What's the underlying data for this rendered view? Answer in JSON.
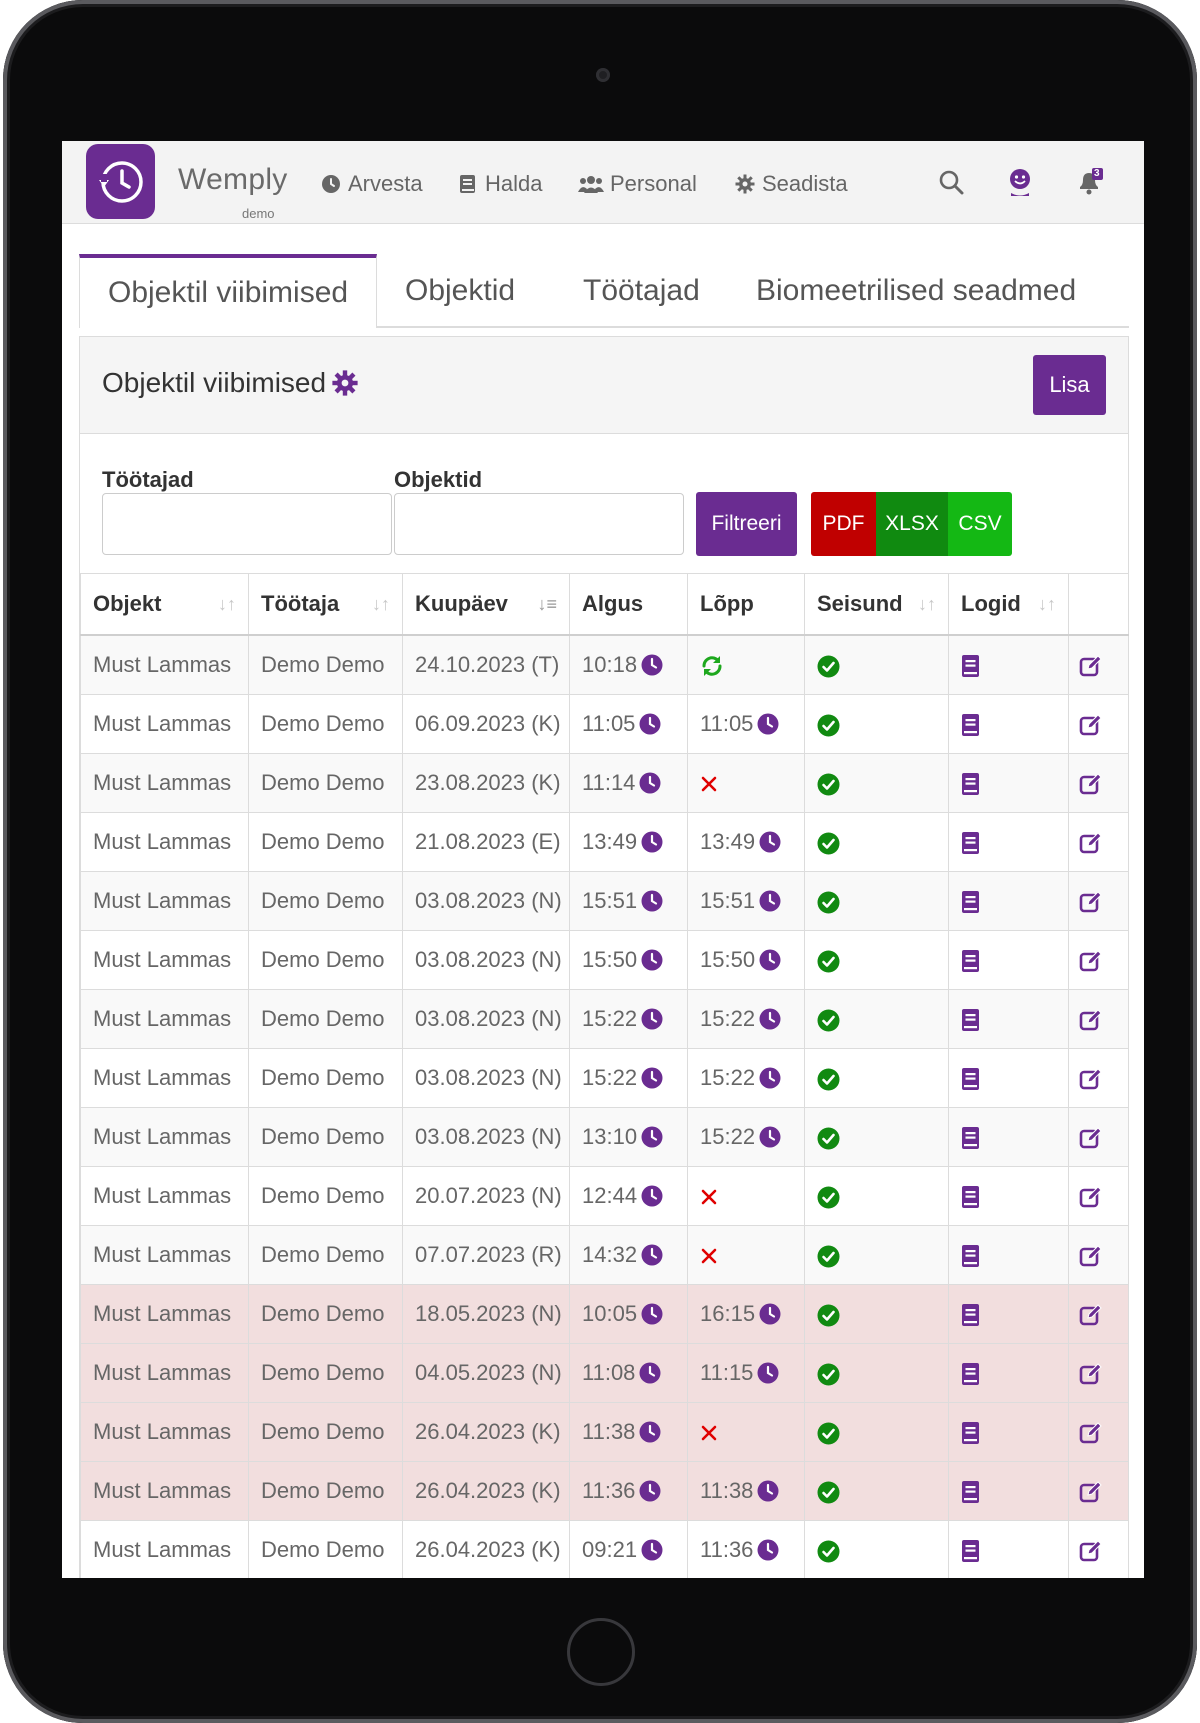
{
  "app": {
    "brand": "Wemply",
    "brand_sub": "demo",
    "nav": [
      {
        "label": "Arvesta",
        "icon": "clock-icon"
      },
      {
        "label": "Halda",
        "icon": "book-icon"
      },
      {
        "label": "Personal",
        "icon": "users-icon"
      },
      {
        "label": "Seadista",
        "icon": "gear-icon"
      }
    ],
    "notification_count": "3",
    "accent": "#6a2c91"
  },
  "tabs": [
    {
      "label": "Objektil viibimised",
      "active": true
    },
    {
      "label": "Objektid",
      "active": false
    },
    {
      "label": "Töötajad",
      "active": false
    },
    {
      "label": "Biomeetrilised seadmed",
      "active": false
    }
  ],
  "panel": {
    "title": "Objektil viibimised",
    "add_label": "Lisa"
  },
  "filters": {
    "employees_label": "Töötajad",
    "employees_value": "",
    "objects_label": "Objektid",
    "objects_value": "",
    "filter_label": "Filtreeri",
    "pdf_label": "PDF",
    "xlsx_label": "XLSX",
    "csv_label": "CSV",
    "pdf_color": "#c00000",
    "xlsx_color": "#108a10",
    "csv_color": "#14b814"
  },
  "table": {
    "headers": {
      "objekt": "Objekt",
      "tootaja": "Töötaja",
      "kuupaev": "Kuupäev",
      "algus": "Algus",
      "lopp": "Lõpp",
      "seisund": "Seisund",
      "logid": "Logid"
    },
    "rows": [
      {
        "objekt": "Must Lammas",
        "tootaja": "Demo Demo",
        "kuupaev": "24.10.2023 (T)",
        "algus": "10:18",
        "lopp": "",
        "lopp_state": "active",
        "highlight": false
      },
      {
        "objekt": "Must Lammas",
        "tootaja": "Demo Demo",
        "kuupaev": "06.09.2023 (K)",
        "algus": "11:05",
        "lopp": "11:05",
        "lopp_state": "time",
        "highlight": false
      },
      {
        "objekt": "Must Lammas",
        "tootaja": "Demo Demo",
        "kuupaev": "23.08.2023 (K)",
        "algus": "11:14",
        "lopp": "",
        "lopp_state": "missing",
        "highlight": false
      },
      {
        "objekt": "Must Lammas",
        "tootaja": "Demo Demo",
        "kuupaev": "21.08.2023 (E)",
        "algus": "13:49",
        "lopp": "13:49",
        "lopp_state": "time",
        "highlight": false
      },
      {
        "objekt": "Must Lammas",
        "tootaja": "Demo Demo",
        "kuupaev": "03.08.2023 (N)",
        "algus": "15:51",
        "lopp": "15:51",
        "lopp_state": "time",
        "highlight": false
      },
      {
        "objekt": "Must Lammas",
        "tootaja": "Demo Demo",
        "kuupaev": "03.08.2023 (N)",
        "algus": "15:50",
        "lopp": "15:50",
        "lopp_state": "time",
        "highlight": false
      },
      {
        "objekt": "Must Lammas",
        "tootaja": "Demo Demo",
        "kuupaev": "03.08.2023 (N)",
        "algus": "15:22",
        "lopp": "15:22",
        "lopp_state": "time",
        "highlight": false
      },
      {
        "objekt": "Must Lammas",
        "tootaja": "Demo Demo",
        "kuupaev": "03.08.2023 (N)",
        "algus": "15:22",
        "lopp": "15:22",
        "lopp_state": "time",
        "highlight": false
      },
      {
        "objekt": "Must Lammas",
        "tootaja": "Demo Demo",
        "kuupaev": "03.08.2023 (N)",
        "algus": "13:10",
        "lopp": "15:22",
        "lopp_state": "time",
        "highlight": false
      },
      {
        "objekt": "Must Lammas",
        "tootaja": "Demo Demo",
        "kuupaev": "20.07.2023 (N)",
        "algus": "12:44",
        "lopp": "",
        "lopp_state": "missing",
        "highlight": false
      },
      {
        "objekt": "Must Lammas",
        "tootaja": "Demo Demo",
        "kuupaev": "07.07.2023 (R)",
        "algus": "14:32",
        "lopp": "",
        "lopp_state": "missing",
        "highlight": false
      },
      {
        "objekt": "Must Lammas",
        "tootaja": "Demo Demo",
        "kuupaev": "18.05.2023 (N)",
        "algus": "10:05",
        "lopp": "16:15",
        "lopp_state": "time",
        "highlight": true
      },
      {
        "objekt": "Must Lammas",
        "tootaja": "Demo Demo",
        "kuupaev": "04.05.2023 (N)",
        "algus": "11:08",
        "lopp": "11:15",
        "lopp_state": "time",
        "highlight": true
      },
      {
        "objekt": "Must Lammas",
        "tootaja": "Demo Demo",
        "kuupaev": "26.04.2023 (K)",
        "algus": "11:38",
        "lopp": "",
        "lopp_state": "missing",
        "highlight": true
      },
      {
        "objekt": "Must Lammas",
        "tootaja": "Demo Demo",
        "kuupaev": "26.04.2023 (K)",
        "algus": "11:36",
        "lopp": "11:38",
        "lopp_state": "time",
        "highlight": true
      },
      {
        "objekt": "Must Lammas",
        "tootaja": "Demo Demo",
        "kuupaev": "26.04.2023 (K)",
        "algus": "09:21",
        "lopp": "11:36",
        "lopp_state": "time",
        "highlight": false
      }
    ]
  }
}
